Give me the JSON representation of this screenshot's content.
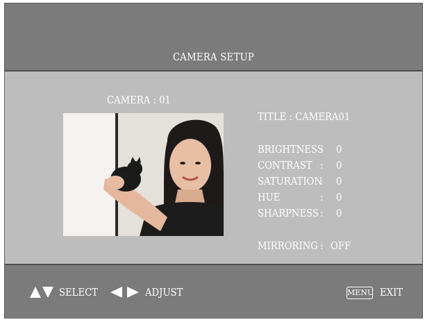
{
  "header": {
    "title": "CAMERA SETUP"
  },
  "camera": {
    "label": "CAMERA : 01"
  },
  "settings": {
    "title": "TITLE : CAMERA01",
    "rows": [
      {
        "label": "BRIGHTNESS",
        "value": "0"
      },
      {
        "label": "CONTRAST",
        "value": "0"
      },
      {
        "label": "SATURATION",
        "value": "0"
      },
      {
        "label": "HUE",
        "value": "0"
      },
      {
        "label": "SHARPNESS",
        "value": "0"
      }
    ],
    "mirroring_label": "MIRRORING",
    "mirroring_value": "OFF"
  },
  "footer": {
    "select_label": "SELECT",
    "adjust_label": "ADJUST",
    "menu_key": "MENU",
    "exit_label": "EXIT"
  },
  "icons": {
    "up_down": "up-down-arrows-icon",
    "left_right": "left-right-arrows-icon"
  },
  "colors": {
    "header_bg": "#7b7b7b",
    "panel_bg": "#bdbdbd",
    "text": "#ffffff"
  }
}
